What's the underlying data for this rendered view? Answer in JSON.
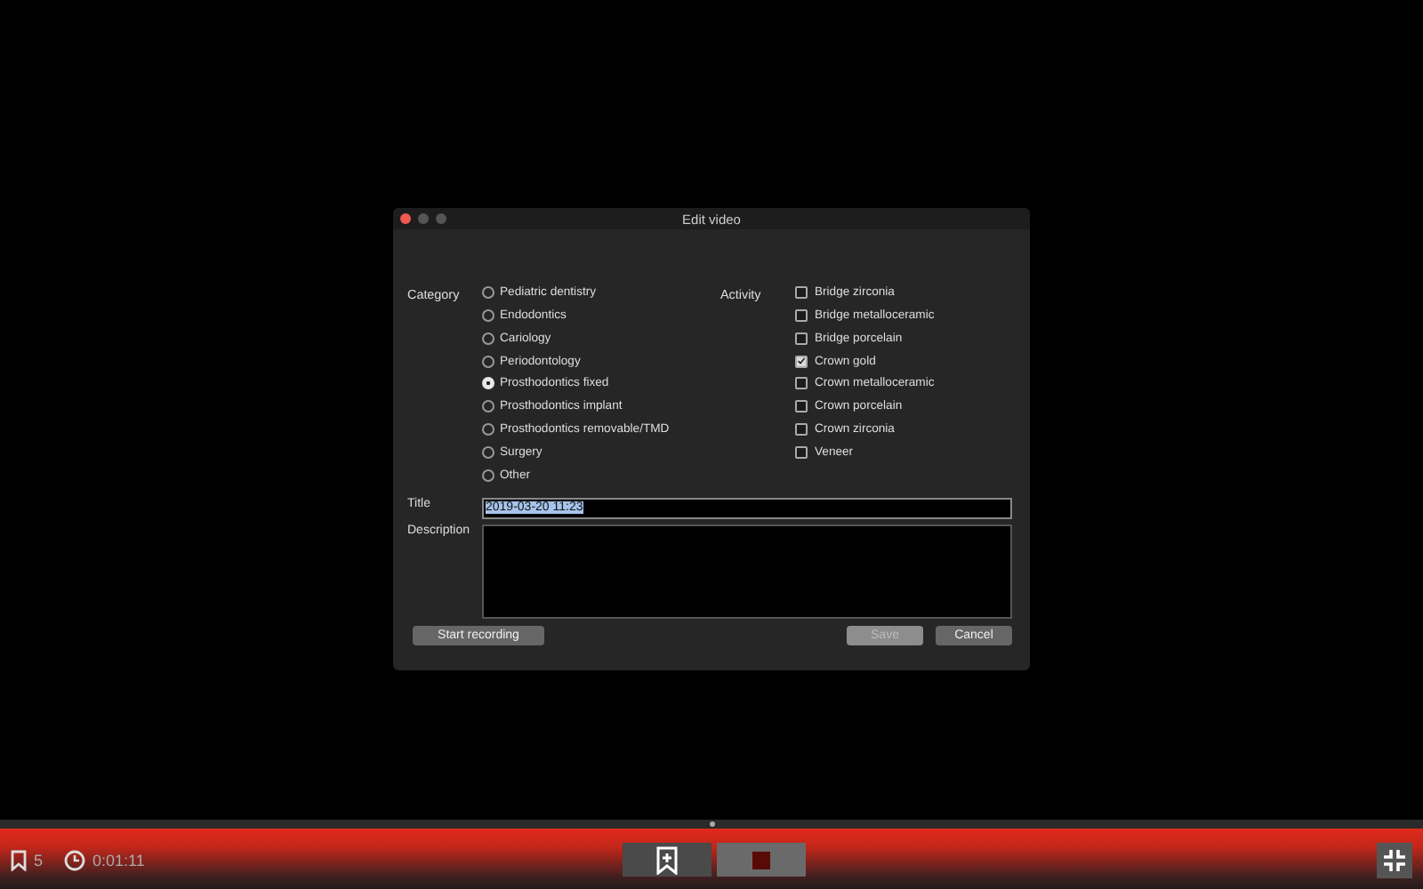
{
  "window": {
    "title": "Edit video"
  },
  "category": {
    "label": "Category",
    "options": [
      {
        "label": "Pediatric dentistry",
        "selected": false
      },
      {
        "label": "Endodontics",
        "selected": false
      },
      {
        "label": "Cariology",
        "selected": false
      },
      {
        "label": "Periodontology",
        "selected": false
      },
      {
        "label": "Prosthodontics fixed",
        "selected": true
      },
      {
        "label": "Prosthodontics implant",
        "selected": false
      },
      {
        "label": "Prosthodontics removable/TMD",
        "selected": false
      },
      {
        "label": "Surgery",
        "selected": false
      },
      {
        "label": "Other",
        "selected": false
      }
    ]
  },
  "activity": {
    "label": "Activity",
    "options": [
      {
        "label": "Bridge zirconia",
        "checked": false
      },
      {
        "label": "Bridge metalloceramic",
        "checked": false
      },
      {
        "label": "Bridge porcelain",
        "checked": false
      },
      {
        "label": "Crown gold",
        "checked": true
      },
      {
        "label": "Crown metalloceramic",
        "checked": false
      },
      {
        "label": "Crown porcelain",
        "checked": false
      },
      {
        "label": "Crown zirconia",
        "checked": false
      },
      {
        "label": "Veneer",
        "checked": false
      }
    ]
  },
  "title_field": {
    "label": "Title",
    "value": "2019-03-20 11:23",
    "text_selected": true
  },
  "description_field": {
    "label": "Description"
  },
  "buttons": [
    {
      "label": "Start recording",
      "disabled": false
    },
    {
      "label": "Save",
      "disabled": true
    },
    {
      "label": "Cancel",
      "disabled": false
    }
  ],
  "player_bar": {
    "bookmarks": "5",
    "time": "0:01:11"
  }
}
